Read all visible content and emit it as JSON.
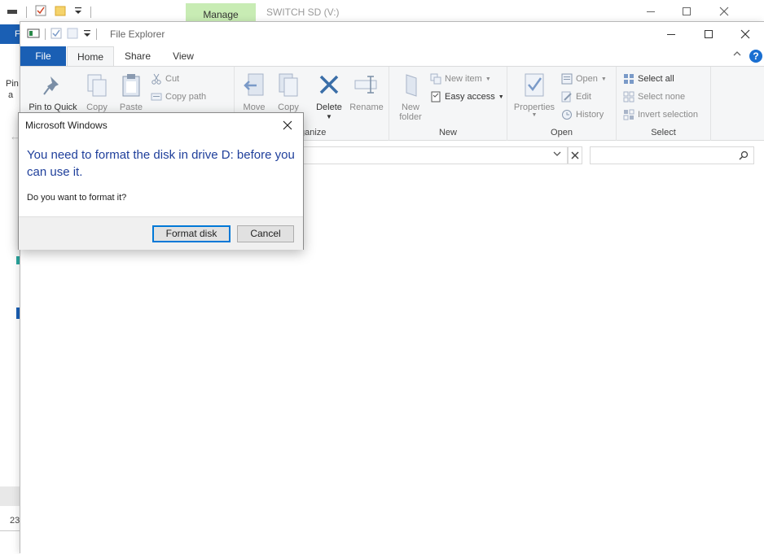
{
  "background_window": {
    "contextual_tab": "Manage",
    "title": "SWITCH SD (V:)",
    "ribbon_file_tab_fragment": "F",
    "ribbon_fragment_1": "Pin",
    "ribbon_fragment_2": "a",
    "item_count_fragment": "23"
  },
  "explorer": {
    "title": "File Explorer",
    "tabs": {
      "file": "File",
      "home": "Home",
      "share": "Share",
      "view": "View"
    },
    "help_glyph": "?",
    "ribbon": {
      "clipboard": {
        "pin": "Pin to Quick",
        "copy": "Copy",
        "paste": "Paste",
        "cut": "Cut",
        "copy_path": "Copy path"
      },
      "organize": {
        "move": "Move",
        "copy": "Copy",
        "delete": "Delete",
        "rename": "Rename",
        "label": "Organize",
        "label_visible": "ganize"
      },
      "new": {
        "new_folder_line1": "New",
        "new_folder_line2": "folder",
        "new_item": "New item",
        "easy_access": "Easy access",
        "label": "New"
      },
      "open": {
        "properties": "Properties",
        "open": "Open",
        "edit": "Edit",
        "history": "History",
        "label": "Open"
      },
      "select": {
        "select_all": "Select all",
        "select_none": "Select none",
        "invert_selection": "Invert selection",
        "label": "Select"
      }
    }
  },
  "dialog": {
    "title": "Microsoft Windows",
    "heading": "You need to format the disk in drive D: before you can use it.",
    "body": "Do you want to format it?",
    "primary_button": "Format disk",
    "cancel_button": "Cancel"
  },
  "colors": {
    "accent": "#1a5fb4",
    "heading_blue": "#1f3f9b",
    "manage_tab": "#c8ecb4",
    "ribbon_bg": "#f5f6f7"
  }
}
